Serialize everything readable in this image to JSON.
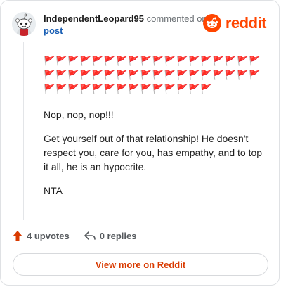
{
  "comment": {
    "author": "IndependentLeopard95",
    "action": "commented on",
    "post_link": "post",
    "brand": "reddit",
    "flags": [
      "🚩🚩🚩🚩🚩🚩🚩🚩🚩🚩🚩🚩🚩🚩🚩🚩🚩🚩",
      "🚩🚩🚩🚩🚩🚩🚩🚩🚩🚩🚩🚩🚩🚩🚩🚩🚩🚩",
      "🚩🚩🚩🚩🚩🚩🚩🚩🚩🚩🚩🚩🚩🚩"
    ],
    "paragraphs": [
      "Nop, nop, nop!!!",
      "Get yourself out of that relationship! He doesn't respect you, care for you, has empathy, and to top it all, he is an hypocrite.",
      "NTA"
    ]
  },
  "actions": {
    "upvotes": "4 upvotes",
    "replies": "0 replies"
  },
  "footer": {
    "view_more": "View more on Reddit"
  },
  "colors": {
    "brand": "#ff4500",
    "upvote": "#d93a00",
    "link": "#1a5fb4"
  }
}
